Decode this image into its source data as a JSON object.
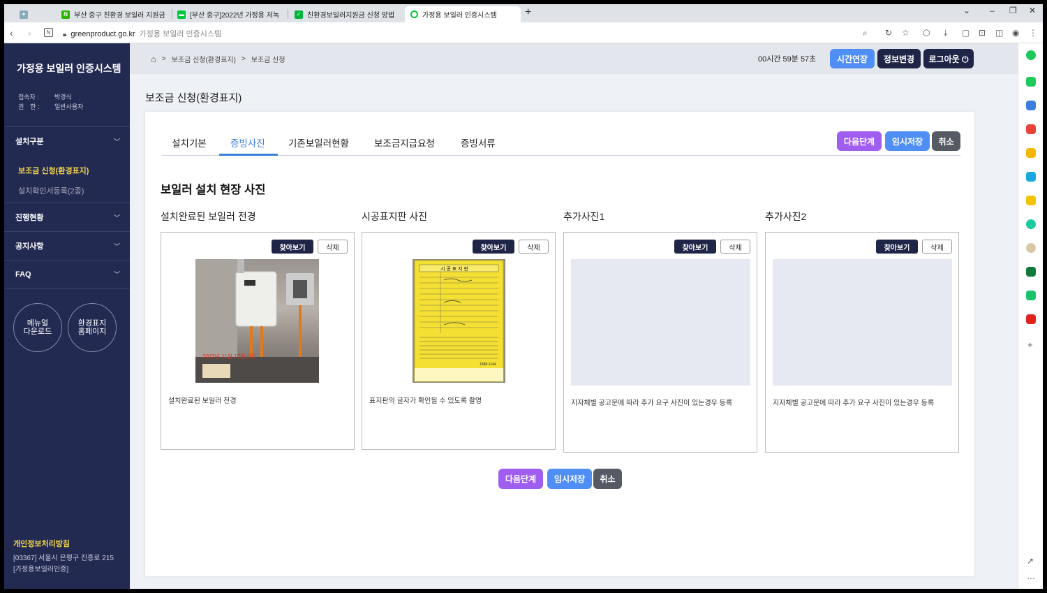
{
  "browser": {
    "tabs": [
      {
        "label": "부산 중구 친환경 보일러 지원금",
        "color": "#2db400",
        "glyph": "N"
      },
      {
        "label": "[부산 중구]2022년 가정용 저녹",
        "color": "#00c73c",
        "glyph": "▬"
      },
      {
        "label": "친환경보일러지원금 신청 방법",
        "color": "#00b33c",
        "glyph": "✓"
      },
      {
        "label": "가정용 보일러 인증시스템",
        "color": "#00c73c",
        "glyph": "○"
      }
    ],
    "url_domain": "greenproduct.go.kr",
    "url_title": "가정용 보일러 인증시스템"
  },
  "sidebar": {
    "app_title": "가정용 보일러 인증시스템",
    "user_label_key": "접속자 :",
    "user_name": "박경식",
    "role_label_key": "권　한 :",
    "role": "일반사용자",
    "sections": [
      {
        "label": "설치구분"
      },
      {
        "label": "진행현황"
      },
      {
        "label": "공지사항"
      },
      {
        "label": "FAQ"
      }
    ],
    "submenu": [
      {
        "label": "보조금 신청(환경표지)"
      },
      {
        "label": "설치확인서등록(2종)"
      }
    ],
    "manual_btn": "메뉴얼\n다운로드",
    "manual_line1": "메뉴얼",
    "manual_line2": "다운로드",
    "home_line1": "환경표지",
    "home_line2": "홈페이지",
    "privacy": "개인정보처리방침",
    "address": "[03367] 서울시 은평구 진흥로 215 [가정용보일러인증]"
  },
  "topbar": {
    "crumb1": "보조금 신청(환경표지)",
    "crumb2": "보조금 신청",
    "timer": "00시간 59분 57초",
    "extend": "시간연장",
    "edit_info": "정보변경",
    "logout": "로그아웃 ⏻"
  },
  "page": {
    "title": "보조금 신청(환경표지)",
    "tabs": [
      "설치기본",
      "증빙사진",
      "기존보일러현황",
      "보조금지급요청",
      "증빙서류"
    ],
    "next": "다음단계",
    "temp_save": "임시저장",
    "cancel": "취소",
    "section_title": "보일러 설치 현장 사진",
    "find_label": "찾아보기",
    "delete_label": "삭제",
    "photos": [
      {
        "title": "설치완료된 보일러 전경",
        "caption": "설치완료된 보일러 전경",
        "stamp": "2022년 11월 17일 (목)"
      },
      {
        "title": "시공표지판 사진",
        "caption": "표지판의 글자가 확인될 수 있도록 촬영",
        "sign_header": "시 공 표 지 판",
        "sign_phone": "1588-1144"
      },
      {
        "title": "추가사진1",
        "caption": "지자체별 공고문에 따라 추가 요구 사진이 있는경우 등록"
      },
      {
        "title": "추가사진2",
        "caption": "지자체별 공고문에 따라 추가 요구 사진이 있는경우 등록"
      }
    ]
  }
}
